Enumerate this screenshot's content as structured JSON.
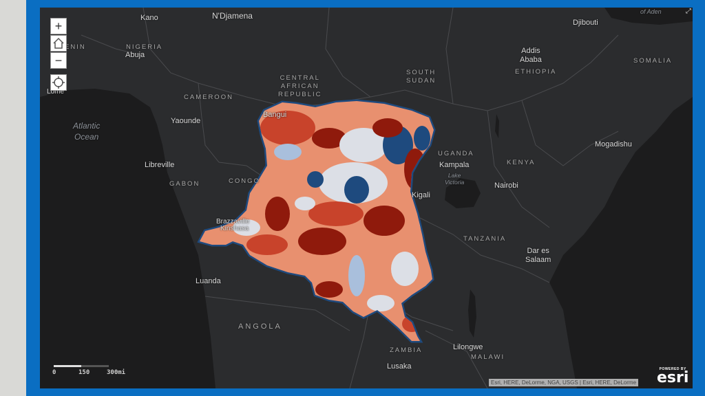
{
  "controls": {
    "zoom_in": "+",
    "zoom_out": "−",
    "home_icon": "home-icon",
    "locate_icon": "locate-icon"
  },
  "labels": {
    "kano": "Kano",
    "ndjamena": "N'Djamena",
    "nigeria": "NIGERIA",
    "abuja": "Abuja",
    "benin_partial": "ENIN",
    "lome": "Lomé",
    "cameroon": "CAMEROON",
    "yaounde": "Yaounde",
    "car": "CENTRAL\nAFRICAN\nREPUBLIC",
    "bangui": "Bangui",
    "south_sudan": "SOUTH\nSUDAN",
    "addis": "Addis\nAbaba",
    "ethiopia": "ETHIOPIA",
    "djibouti": "Djibouti",
    "gulf_partial": "of Aden",
    "somalia": "SOMALIA",
    "atlantic": "Atlantic\nOcean",
    "libreville": "Libreville",
    "gabon": "GABON",
    "congo": "CONGO",
    "uganda": "UGANDA",
    "kampala": "Kampala",
    "lake_victoria": "Lake\nVictoria",
    "kenya": "KENYA",
    "nairobi": "Nairobi",
    "mogadishu": "Mogadishu",
    "kigali": "Kigali",
    "brazzaville": "Brazzaville",
    "kinshasa": "Kinshasa",
    "tanzania": "TANZANIA",
    "dar": "Dar es\nSalaam",
    "luanda": "Luanda",
    "angola": "ANGOLA",
    "zambia": "ZAMBIA",
    "lilongwe": "Lilongwe",
    "malawi": "MALAWI",
    "lusaka": "Lusaka"
  },
  "scale": {
    "t0": "0",
    "t1": "150",
    "t2": "300mi"
  },
  "attribution": "Esri, HERE, DeLorme, NGA, USGS | Esri, HERE, DeLorme",
  "esri": {
    "powered": "POWERED BY",
    "name": "esri"
  },
  "colors": {
    "frame": "#0a6ec2",
    "basemap_land": "#2b2c2e",
    "water": "#1a1a1b",
    "dark_red": "#8f1a0c",
    "red": "#c8432b",
    "salmon": "#e8906f",
    "light": "#dcdfe6",
    "light_blue": "#a9bfdc",
    "dark_blue": "#1e4a7e"
  }
}
